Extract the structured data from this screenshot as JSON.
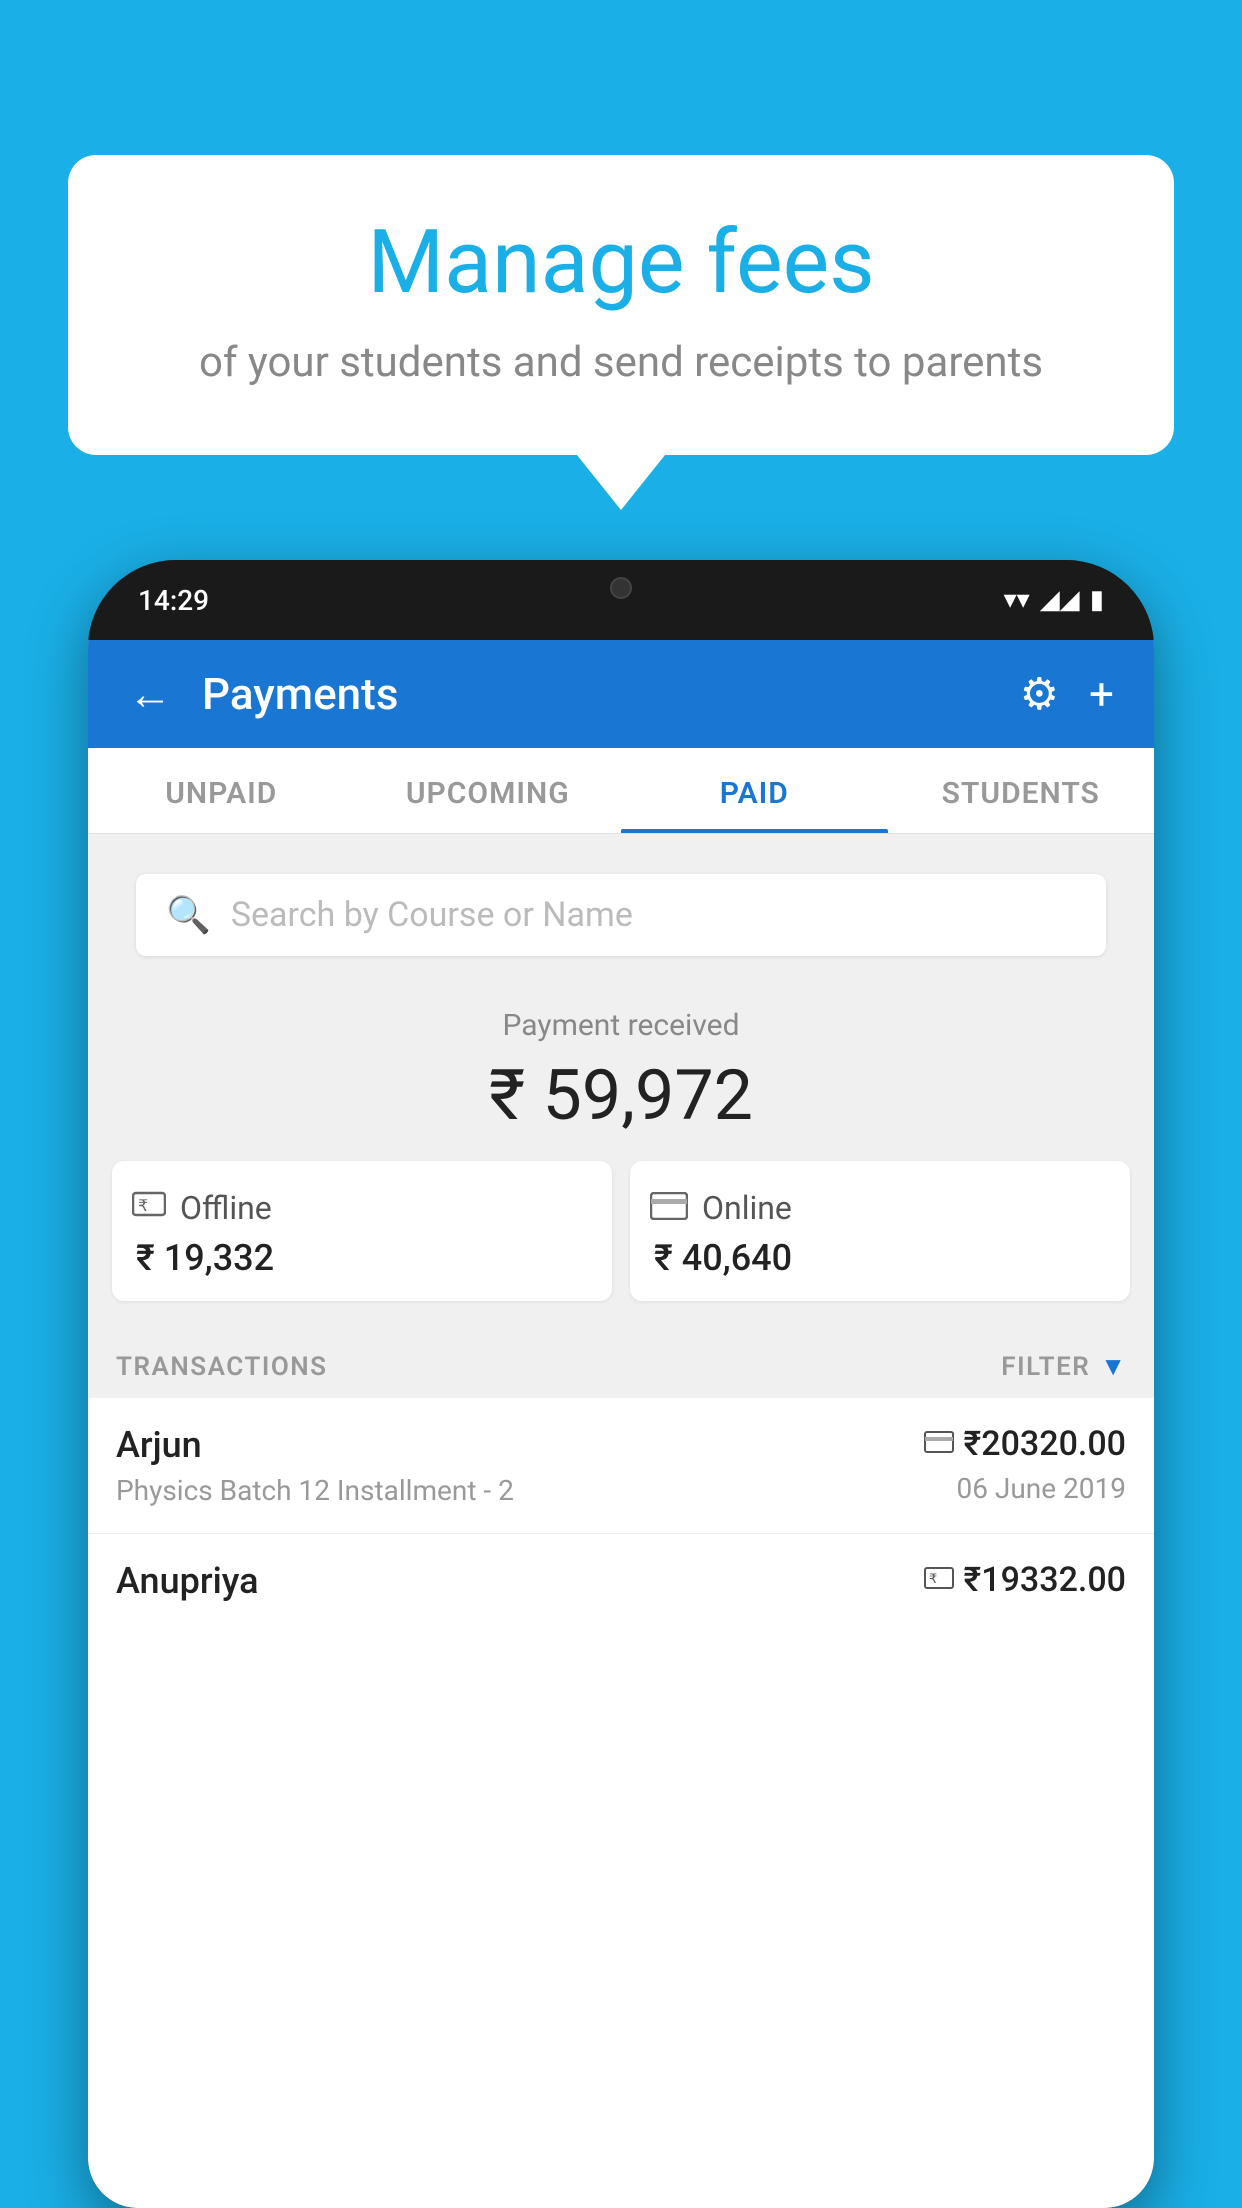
{
  "background_color": "#1AAFE6",
  "speech_bubble": {
    "title": "Manage fees",
    "subtitle": "of your students and send receipts to parents"
  },
  "phone": {
    "status_bar": {
      "time": "14:29",
      "wifi": "▼",
      "signal": "◀",
      "battery": "▮"
    },
    "header": {
      "back_label": "←",
      "title": "Payments",
      "gear_label": "⚙",
      "plus_label": "+"
    },
    "tabs": [
      {
        "label": "UNPAID",
        "active": false
      },
      {
        "label": "UPCOMING",
        "active": false
      },
      {
        "label": "PAID",
        "active": true
      },
      {
        "label": "STUDENTS",
        "active": false
      }
    ],
    "search": {
      "placeholder": "Search by Course or Name"
    },
    "payment_summary": {
      "label": "Payment received",
      "amount": "₹ 59,972",
      "offline": {
        "icon": "💳",
        "label": "Offline",
        "amount": "₹ 19,332"
      },
      "online": {
        "icon": "💳",
        "label": "Online",
        "amount": "₹ 40,640"
      }
    },
    "transactions": {
      "section_label": "TRANSACTIONS",
      "filter_label": "FILTER",
      "items": [
        {
          "name": "Arjun",
          "course": "Physics Batch 12 Installment - 2",
          "amount": "₹20320.00",
          "date": "06 June 2019",
          "payment_type": "card"
        },
        {
          "name": "Anupriya",
          "course": "",
          "amount": "₹19332.00",
          "date": "",
          "payment_type": "cash"
        }
      ]
    }
  }
}
